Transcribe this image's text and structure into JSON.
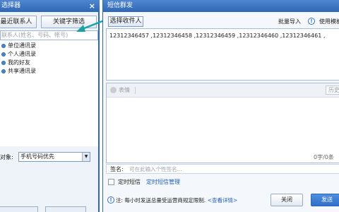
{
  "left": {
    "title": "选择器",
    "close_glyph": "×",
    "tab_recent": "最近联系人",
    "tab_keyword": "关键字筛选",
    "search_placeholder": "联系人(姓名、号码、帐号)",
    "tree_items": [
      {
        "label": "单位通讯录"
      },
      {
        "label": "个人通讯录"
      },
      {
        "label": "我的好友"
      },
      {
        "label": "共享通讯录"
      }
    ],
    "target_label": "对象:",
    "target_value": "手机号码优先",
    "dropdown_glyph": "▼"
  },
  "right": {
    "title": "短信群发",
    "select_recipients": "选择收件人",
    "bulk_import": "批量导入",
    "info_glyph": "!",
    "use_template": "使用模板",
    "recipients": "12312346457 ,12312346458 ,12312346459 ,12312346460 ,12312346461 ,",
    "emoji_label": "表情",
    "history_label": "历史",
    "char_count": "0字/0条",
    "signature_label": "签名:",
    "signature_placeholder": "可在此输入个性签名...",
    "scheduled_label": "定时短信",
    "scheduled_manage": "定时短信管理",
    "notice_text": "注: 每小时发送总量受运营商规定限制.",
    "notice_link": "<查看详情>",
    "close_button": "关闭",
    "send_button": "发送"
  },
  "colors": {
    "title_bar": "#2f68b5",
    "accent_arrow": "#1aa3a3",
    "link": "#1f5fb8"
  },
  "icons": {
    "arrow": "teal-arrow-icon",
    "emoji": "smiley-icon",
    "info": "info-circle-icon",
    "close": "close-icon",
    "tree_node": "contact-group-icon"
  }
}
